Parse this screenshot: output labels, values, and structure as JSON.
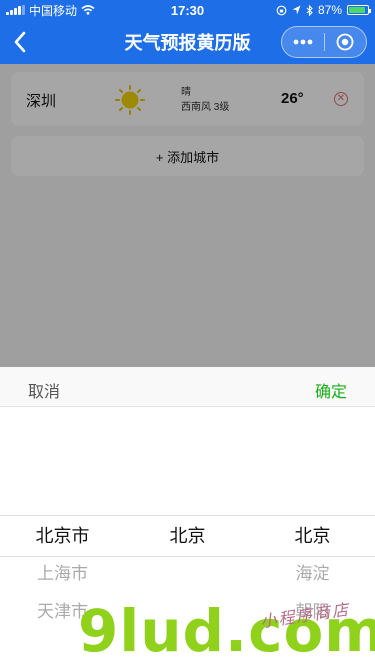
{
  "status_bar": {
    "carrier": "中国移动",
    "time": "17:30",
    "battery_percent": "87%",
    "battery_level": 0.87,
    "battery_color": "#4cd964"
  },
  "nav": {
    "title": "天气预报黄历版",
    "back_icon": "chevron-left-icon",
    "more_icon": "more-dots-icon",
    "close_icon": "target-circle-icon",
    "bar_color": "#1e6ee8"
  },
  "weather_card": {
    "city": "深圳",
    "icon": "sun-icon",
    "condition": "晴",
    "wind": "西南风 3级",
    "temperature": "26°",
    "delete_icon": "close-circle-icon"
  },
  "add_city": {
    "label": "+ 添加城市"
  },
  "picker": {
    "cancel_label": "取消",
    "confirm_label": "确定",
    "confirm_color": "#1aad19",
    "columns": [
      {
        "selected": "北京市",
        "options": [
          "北京市",
          "上海市",
          "天津市"
        ]
      },
      {
        "selected": "北京",
        "options": [
          "北京"
        ]
      },
      {
        "selected": "北京",
        "options": [
          "北京",
          "海淀",
          "朝阳"
        ]
      }
    ]
  },
  "watermark": {
    "main": "9lud.com",
    "sub": "小程序商店"
  }
}
